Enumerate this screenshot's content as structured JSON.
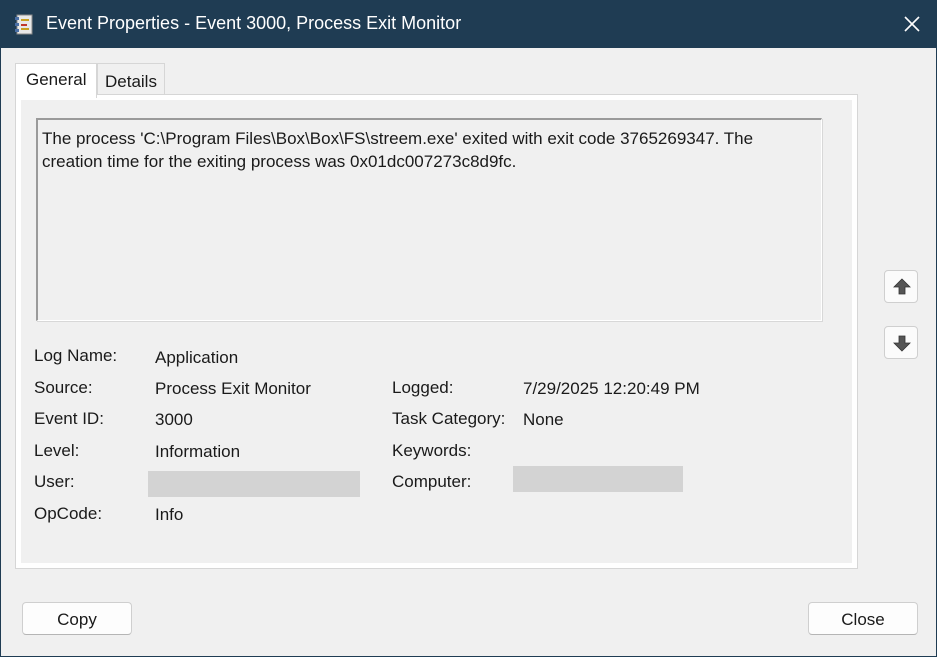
{
  "window": {
    "title": "Event Properties - Event 3000, Process Exit Monitor"
  },
  "tabs": [
    {
      "label": "General"
    },
    {
      "label": "Details"
    }
  ],
  "event": {
    "description": "The process 'C:\\Program Files\\Box\\Box\\FS\\streem.exe' exited with exit code 3765269347. The creation time for the exiting process was 0x01dc007273c8d9fc.",
    "fields_left": [
      {
        "label": "Log Name:",
        "value": "Application"
      },
      {
        "label": "Source:",
        "value": "Process Exit Monitor"
      },
      {
        "label": "Event ID:",
        "value": "3000"
      },
      {
        "label": "Level:",
        "value": "Information"
      },
      {
        "label": "User:",
        "value": ""
      },
      {
        "label": "OpCode:",
        "value": "Info"
      }
    ],
    "fields_right": [
      {
        "label": "Logged:",
        "value": "7/29/2025 12:20:49 PM"
      },
      {
        "label": "Task Category:",
        "value": "None"
      },
      {
        "label": "Keywords:",
        "value": ""
      },
      {
        "label": "Computer:",
        "value": ""
      }
    ]
  },
  "buttons": {
    "copy_label": "Copy",
    "close_label": "Close"
  },
  "icons": {
    "app": "event-viewer-icon",
    "close": "close-icon",
    "up": "arrow-up-icon",
    "down": "arrow-down-icon"
  },
  "colors": {
    "titlebar": "#1f3c53",
    "redaction": "#d3d3d3"
  }
}
